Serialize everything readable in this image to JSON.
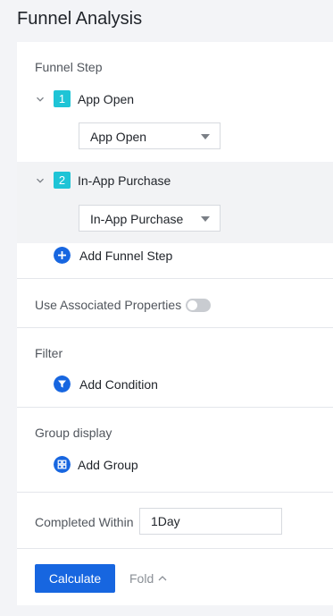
{
  "page": {
    "title": "Funnel Analysis"
  },
  "funnel": {
    "section_label": "Funnel Step",
    "steps": [
      {
        "number": "1",
        "name": "App Open",
        "selected_event": "App Open",
        "expanded": true
      },
      {
        "number": "2",
        "name": "In-App Purchase",
        "selected_event": "In-App Purchase",
        "expanded": true
      }
    ],
    "add_step_label": "Add Funnel Step"
  },
  "associated": {
    "label": "Use Associated Properties",
    "enabled": false
  },
  "filter": {
    "section_label": "Filter",
    "add_label": "Add Condition"
  },
  "group": {
    "section_label": "Group display",
    "add_label": "Add Group"
  },
  "completed": {
    "label": "Completed Within",
    "value": "1Day"
  },
  "footer": {
    "calculate_label": "Calculate",
    "fold_label": "Fold"
  },
  "colors": {
    "accent": "#1766e0",
    "step_badge": "#1fc4d6",
    "shaded_row": "#f2f3f5",
    "divider": "#e4e6eb"
  },
  "icons": {
    "collapse": "chevron-down-icon",
    "add": "plus-circle-icon",
    "filter": "filter-funnel-icon",
    "group": "group-grid-icon",
    "fold": "chevron-up-icon"
  }
}
